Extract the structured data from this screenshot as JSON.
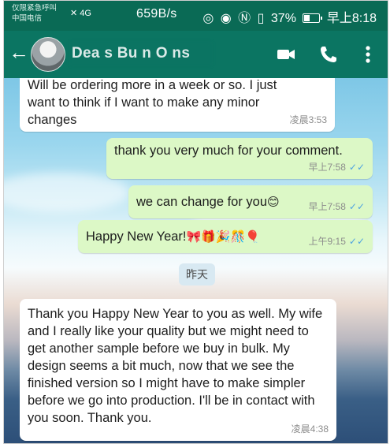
{
  "status_bar": {
    "carrier_line1": "仅限紧急呼叫",
    "carrier_line2": "中国电信",
    "network_left": "✕ 4G",
    "speed": "659B/s",
    "battery_percent": "37%",
    "time": "早上8:18"
  },
  "header": {
    "back_icon": "arrow-left-icon",
    "contact_name": "Dea s Bu n O ns",
    "icons": [
      "video-call-icon",
      "phone-icon",
      "more-vert-icon"
    ]
  },
  "messages": [
    {
      "direction": "in",
      "text": "Will be ordering more in a week or so. I just want to think if I want to make any minor changes",
      "time": "凌晨3:53"
    },
    {
      "direction": "out",
      "text": "thank you very much for your comment.",
      "time": "早上7:58",
      "ticks": "✓✓"
    },
    {
      "direction": "out",
      "text": "we can change for you",
      "emoji": "😊",
      "time": "早上7:58",
      "ticks": "✓✓"
    },
    {
      "direction": "out",
      "text": "Happy New Year!",
      "emoji": "🎀🎁🎉🎊🎈",
      "time": "上午9:15",
      "ticks": "✓✓"
    },
    {
      "direction": "in",
      "text": "Thank you Happy New Year to you as well. My wife and I really like your quality but we might need to get another sample before we buy in bulk. My design seems a bit much, now that we see the finished version so I might have to make simpler before we go into production. I'll be in contact with you soon. Thank you.",
      "time": "凌晨4:38"
    }
  ],
  "date_separator": "昨天",
  "colors": {
    "header": "#0b7562",
    "statusbar": "#0a6a55",
    "outgoing_bubble": "#dcf8c6",
    "incoming_bubble": "#ffffff",
    "read_ticks": "#4fa3e0"
  }
}
